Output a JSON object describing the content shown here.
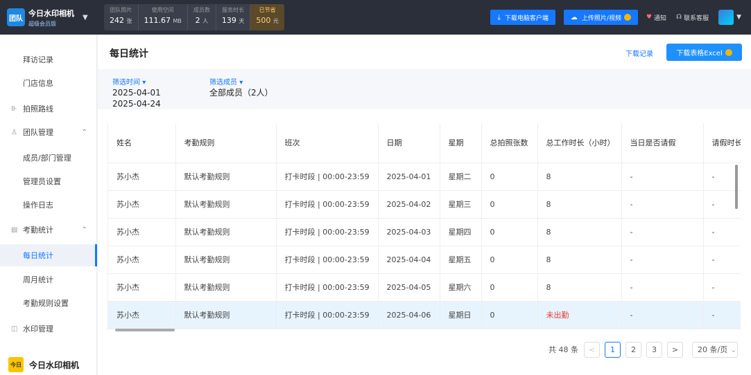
{
  "brand": {
    "logo_text": "团队",
    "name": "今日水印相机",
    "sub": "超级会员版"
  },
  "stats": [
    {
      "label": "团队照片",
      "value": "242",
      "unit": "张"
    },
    {
      "label": "使用空间",
      "value": "111.67",
      "unit": "MB"
    },
    {
      "label": "成员数",
      "value": "2",
      "unit": "人"
    },
    {
      "label": "服务时长",
      "value": "139",
      "unit": "天"
    },
    {
      "label": "已节省",
      "value": "500",
      "unit": "元"
    }
  ],
  "topbar": {
    "download_client": "下载电脑客户端",
    "upload": "上传照片/视频",
    "notice": "通知",
    "support": "联系客服"
  },
  "sidebar": {
    "items": [
      {
        "label": "拜访记录",
        "type": "child"
      },
      {
        "label": "门店信息",
        "type": "child"
      },
      {
        "label": "拍照路线",
        "type": "parent",
        "icon": "route-icon"
      },
      {
        "label": "团队管理",
        "type": "parent",
        "icon": "team-icon",
        "chev": "^"
      },
      {
        "label": "成员/部门管理",
        "type": "child"
      },
      {
        "label": "管理员设置",
        "type": "child"
      },
      {
        "label": "操作日志",
        "type": "child"
      },
      {
        "label": "考勤统计",
        "type": "parent",
        "icon": "attendance-icon",
        "chev": "^"
      },
      {
        "label": "每日统计",
        "type": "child",
        "active": true
      },
      {
        "label": "周月统计",
        "type": "child"
      },
      {
        "label": "考勤规则设置",
        "type": "child"
      },
      {
        "label": "水印管理",
        "type": "parent",
        "icon": "watermark-icon"
      }
    ],
    "footer": {
      "logo_text": "今日",
      "name": "今日水印相机"
    }
  },
  "main": {
    "title": "每日统计",
    "download_records": "下载记录",
    "download_excel": "下载表格Excel",
    "filters": {
      "time_label": "筛选时间",
      "time_start": "2025-04-01",
      "time_end": "2025-04-24",
      "member_label": "筛选成员",
      "member_value": "全部成员（2人）"
    }
  },
  "table": {
    "columns": [
      "姓名",
      "考勤规则",
      "班次",
      "日期",
      "星期",
      "总拍照张数",
      "总工作时长（小时）",
      "当日是否请假",
      "请假时长"
    ],
    "rows": [
      [
        "苏小杰",
        "默认考勤规则",
        "打卡时段 | 00:00-23:59",
        "2025-04-01",
        "星期二",
        "0",
        "8",
        "-",
        "-"
      ],
      [
        "苏小杰",
        "默认考勤规则",
        "打卡时段 | 00:00-23:59",
        "2025-04-02",
        "星期三",
        "0",
        "8",
        "-",
        "-"
      ],
      [
        "苏小杰",
        "默认考勤规则",
        "打卡时段 | 00:00-23:59",
        "2025-04-03",
        "星期四",
        "0",
        "8",
        "-",
        "-"
      ],
      [
        "苏小杰",
        "默认考勤规则",
        "打卡时段 | 00:00-23:59",
        "2025-04-04",
        "星期五",
        "0",
        "8",
        "-",
        "-"
      ],
      [
        "苏小杰",
        "默认考勤规则",
        "打卡时段 | 00:00-23:59",
        "2025-04-05",
        "星期六",
        "0",
        "8",
        "-",
        "-"
      ],
      [
        "苏小杰",
        "默认考勤规则",
        "打卡时段 | 00:00-23:59",
        "2025-04-06",
        "星期日",
        "0",
        "未出勤",
        "-",
        "-"
      ]
    ],
    "highlight_row": 5
  },
  "pagination": {
    "total": "共 48 条",
    "prev": "<",
    "pages": [
      "1",
      "2",
      "3"
    ],
    "current": "1",
    "next": ">",
    "page_size": "20 条/页"
  },
  "colors": {
    "accent": "#1677ff",
    "absent": "#e53935",
    "topbar": "#2b2f3a"
  }
}
